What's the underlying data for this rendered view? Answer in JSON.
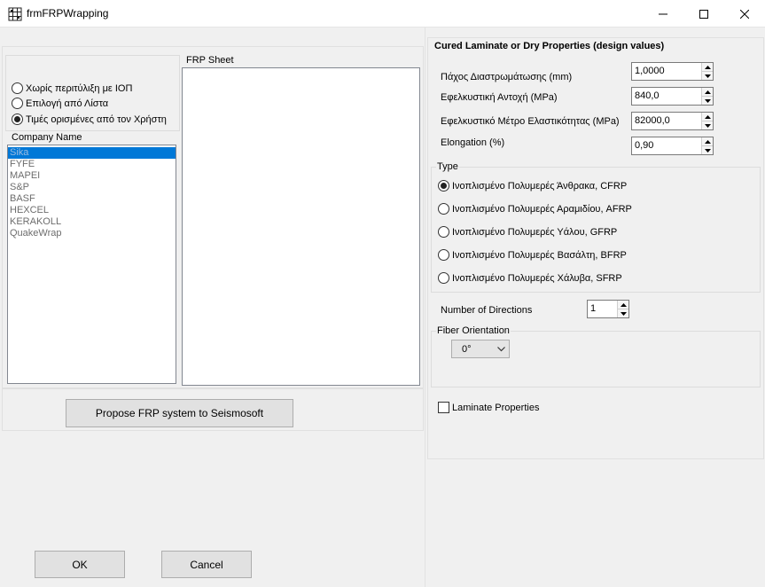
{
  "window": {
    "title": "frmFRPWrapping"
  },
  "left": {
    "options": [
      {
        "label": "Χωρίς περιτύλιξη με ΙΟΠ",
        "checked": false
      },
      {
        "label": "Επιλογή από Λίστα",
        "checked": false
      },
      {
        "label": "Τιμές ορισμένες από τον Χρήστη",
        "checked": true
      }
    ],
    "company_label": "Company Name",
    "companies": [
      "Sika",
      "FYFE",
      "MAPEI",
      "S&P",
      "BASF",
      "HEXCEL",
      "KERAKOLL",
      "QuakeWrap"
    ],
    "frp_sheet_label": "FRP Sheet",
    "propose_button": "Propose FRP system to Seismosoft",
    "ok_button": "OK",
    "cancel_button": "Cancel"
  },
  "right": {
    "heading": "Cured Laminate or Dry Properties (design values)",
    "fields": [
      {
        "label": "Πάχος Διαστρωμάτωσης (mm)",
        "value": "1,0000"
      },
      {
        "label": "Εφελκυστική Αντοχή (MPa)",
        "value": "840,0"
      },
      {
        "label": "Εφελκυστικό Μέτρο Ελαστικότητας (MPa)",
        "value": "82000,0"
      },
      {
        "label": "Elongation (%)",
        "value": "0,90"
      }
    ],
    "type_label": "Type",
    "types": [
      {
        "label": "Ινοπλισμένο Πολυμερές Άνθρακα, CFRP",
        "checked": true
      },
      {
        "label": "Ινοπλισμένο Πολυμερές Αραμιδίου, AFRP",
        "checked": false
      },
      {
        "label": "Ινοπλισμένο Πολυμερές Υάλου, GFRP",
        "checked": false
      },
      {
        "label": "Ινοπλισμένο Πολυμερές Βασάλτη, BFRP",
        "checked": false
      },
      {
        "label": "Ινοπλισμένο Πολυμερές Χάλυβα, SFRP",
        "checked": false
      }
    ],
    "directions_label": "Number of Directions",
    "directions_value": "1",
    "fiber_orientation_label": "Fiber Orientation",
    "fiber_orientation_value": "0°",
    "laminate_label": "Laminate Properties"
  }
}
